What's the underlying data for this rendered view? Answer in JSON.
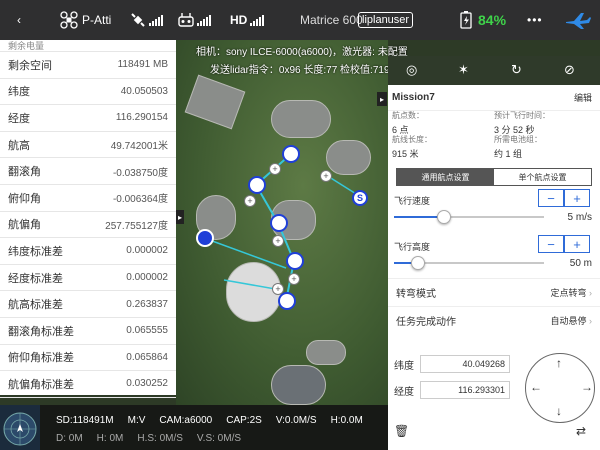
{
  "topbar": {
    "mode": "P-Atti",
    "hd": "HD",
    "model": "Matrice 600",
    "user": "liplanuser",
    "battery": "84%",
    "more": "•••"
  },
  "telemetry": {
    "partial_label": "剩余电量",
    "rows": [
      {
        "label": "剩余空间",
        "value": "118491 MB"
      },
      {
        "label": "纬度",
        "value": "40.050503"
      },
      {
        "label": "经度",
        "value": "116.290154"
      },
      {
        "label": "航高",
        "value": "49.742001米"
      },
      {
        "label": "翻滚角",
        "value": "-0.038750度"
      },
      {
        "label": "俯仰角",
        "value": "-0.006364度"
      },
      {
        "label": "航偏角",
        "value": "257.755127度"
      },
      {
        "label": "纬度标准差",
        "value": "0.000002"
      },
      {
        "label": "经度标准差",
        "value": "0.000002"
      },
      {
        "label": "航高标准差",
        "value": "0.263837"
      },
      {
        "label": "翻滚角标准差",
        "value": "0.065555"
      },
      {
        "label": "俯仰角标准差",
        "value": "0.065864"
      },
      {
        "label": "航偏角标准差",
        "value": "0.030252"
      }
    ]
  },
  "map_info": {
    "camera_line": "相机：sony ILCE-6000(a6000)，激光器: 未配置",
    "lidar_line": "发送lidar指令：0x96 长度:77 检校值:7196"
  },
  "status": {
    "row1": [
      "SD:118491M",
      "M:V",
      "CAM:a6000",
      "CAP:2S",
      "V:0.0M/S",
      "H:0.0M"
    ],
    "row2": [
      "D: 0M",
      "H: 0M",
      "H.S: 0M/S",
      "V.S: 0M/S"
    ]
  },
  "mission": {
    "title": "Mission7",
    "edit": "编辑",
    "waypoints_label": "航点数：",
    "waypoints_value": "6 点",
    "flight_time_label": "预计飞行时间：",
    "flight_time_value": "3 分 52 秒",
    "route_length_label": "航线长度：",
    "route_length_value": "915 米",
    "battery_label": "所需电池组：",
    "battery_value": "约 1 组",
    "tab_general": "通用航点设置",
    "tab_single": "单个航点设置",
    "speed_label": "飞行速度",
    "speed_value": "5 m/s",
    "speed_fraction": 0.33,
    "height_label": "飞行高度",
    "height_value": "50 m",
    "height_fraction": 0.16,
    "turn_mode_label": "转弯模式",
    "turn_mode_value": "定点转弯",
    "finish_action_label": "任务完成动作",
    "finish_action_value": "自动悬停",
    "lat_label": "纬度",
    "lat_value": "40.049268",
    "lon_label": "经度",
    "lon_value": "116.293301",
    "stepper_minus": "−",
    "stepper_plus": "+"
  },
  "colors": {
    "accent": "#2f6bd8",
    "battery_green": "#3fd34a",
    "waypoint": "#1f3fd8",
    "route": "#35c7d8"
  }
}
